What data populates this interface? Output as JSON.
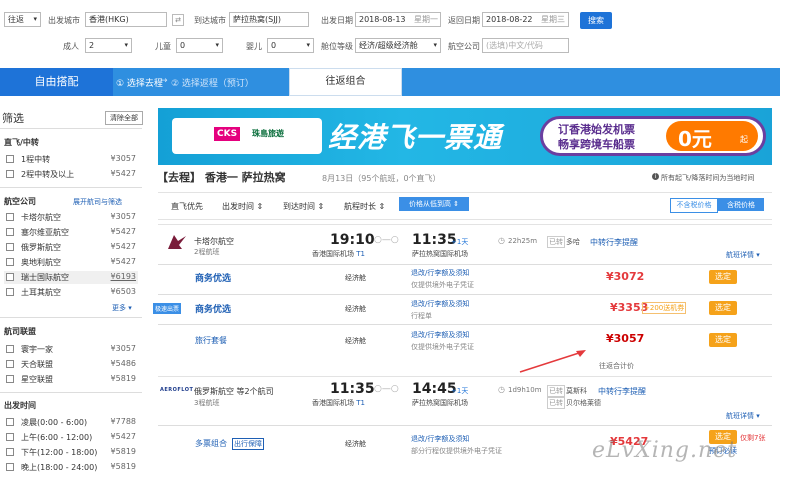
{
  "search": {
    "trip_type": "往返",
    "from_label": "出发城市",
    "from_value": "香港(HKG)",
    "to_label": "到达城市",
    "to_value": "萨拉热窝(SJJ)",
    "depart_label": "出发日期",
    "depart_date": "2018-08-13",
    "depart_weekday": "星期一",
    "return_label": "返回日期",
    "return_date": "2018-08-22",
    "return_weekday": "星期三",
    "search_button": "搜索",
    "adult_label": "成人",
    "adult_value": "2",
    "child_label": "儿童",
    "child_value": "0",
    "infant_label": "婴儿",
    "infant_value": "0",
    "cabin_label": "舱位等级",
    "cabin_value": "经济/超级经济舱",
    "airline_label": "航空公司",
    "airline_placeholder": "(选填)中文/代码"
  },
  "tabs": {
    "free": "自由搭配",
    "step1": "① 选择去程",
    "arrow": "→",
    "step2": "② 选择返程（预订）",
    "roundtrip": "往返组合"
  },
  "sidebar": {
    "title": "筛选",
    "clear": "清除全部",
    "stops_title": "直飞/中转",
    "stops": [
      {
        "label": "1程中转",
        "price": "¥3057"
      },
      {
        "label": "2程中转及以上",
        "price": "¥5427"
      }
    ],
    "airline_title": "航空公司",
    "airline_link": "展开航司与筛选",
    "airlines": [
      {
        "label": "卡塔尔航空",
        "price": "¥3057"
      },
      {
        "label": "塞尔维亚航空",
        "price": "¥5427"
      },
      {
        "label": "俄罗斯航空",
        "price": "¥5427"
      },
      {
        "label": "奥地利航空",
        "price": "¥5427"
      },
      {
        "label": "瑞士国际航空",
        "price": "¥6193"
      },
      {
        "label": "土耳其航空",
        "price": "¥6503"
      }
    ],
    "more": "更多 ▾",
    "alliance_title": "航司联盟",
    "alliances": [
      {
        "label": "寰宇一家",
        "price": "¥3057"
      },
      {
        "label": "天合联盟",
        "price": "¥5486"
      },
      {
        "label": "星空联盟",
        "price": "¥5819"
      }
    ],
    "time_title": "出发时间",
    "times": [
      {
        "label": "凌晨(0:00 - 6:00)",
        "price": "¥7788"
      },
      {
        "label": "上午(6:00 - 12:00)",
        "price": "¥5427"
      },
      {
        "label": "下午(12:00 - 18:00)",
        "price": "¥5819"
      },
      {
        "label": "晚上(18:00 - 24:00)",
        "price": "¥5819"
      }
    ]
  },
  "banner": {
    "logo1": "CKS",
    "logo2": "珠島旅遊",
    "slogan": "经港飞一票通",
    "promo_line1": "订香港始发机票",
    "promo_line2": "畅享跨境车船票",
    "promo_price": "0元",
    "promo_suffix": "起"
  },
  "results": {
    "heading": "【去程】 香港一 萨拉热窝",
    "subheading": "8月13日（95个航班，0个直飞）",
    "note": "所有起飞/降落时间为当地时间",
    "sort": {
      "direct": "直飞优先",
      "depart": "出发时间",
      "arrive": "到达时间",
      "duration": "航程时长",
      "price": "价格从低到高",
      "no_tax": "不含税价格",
      "with_tax": "含税价格"
    },
    "flight1": {
      "airline": "卡塔尔航空",
      "legs": "2程航班",
      "dep_time": "19:10",
      "dep_airport": "香港国际机场",
      "dep_terminal": "T1",
      "arr_time": "11:35",
      "arr_plus": "+1天",
      "arr_airport": "萨拉热窝国际机场",
      "duration": "22h25m",
      "transfer_tag": "已转",
      "transfer_city": "多哈",
      "transit_link": "中转行李提醒",
      "detail_link": "航班详情 ▾",
      "fares": [
        {
          "name": "商务优选",
          "cabin": "经济舱",
          "policy": "退改/行李额及须知",
          "sub": "仅提供境外电子凭证",
          "price": "¥3072",
          "book": "选定"
        },
        {
          "name": "商务优选",
          "cabin": "经济舱",
          "policy": "退改/行李额及须知",
          "sub": "行程单",
          "price": "¥3353",
          "book": "选定",
          "badge": "极速出票",
          "extra": "+200送机券"
        },
        {
          "name": "旅行套餐",
          "cabin": "经济舱",
          "policy": "退改/行李额及须知",
          "sub": "仅提供境外电子凭证",
          "price": "¥3057",
          "book": "选定"
        }
      ],
      "combo_note": "往返合计价"
    },
    "flight2": {
      "airline": "俄罗斯航空 等2个航司",
      "legs": "3程航班",
      "logo_text": "AEROFLOT",
      "dep_time": "11:35",
      "dep_airport": "香港国际机场",
      "dep_terminal": "T1",
      "arr_time": "14:45",
      "arr_plus": "+1天",
      "arr_airport": "萨拉热窝国际机场",
      "duration": "1d9h10m",
      "transfer1": "莫斯科",
      "transfer2": "贝尔格莱德",
      "transit_link": "中转行李提醒",
      "detail_link": "航班详情 ▾",
      "fare_name": "多票组合",
      "fare_tag": "出行保障",
      "cabin": "经济舱",
      "policy": "退改/行李额及须知",
      "sub": "部分行程仅提供境外电子凭证",
      "price": "¥5427",
      "book": "选定",
      "left": "仅剩7张",
      "note2": "预订必读"
    }
  },
  "watermark": "eLvXing.net",
  "colors": {
    "brand": "#1e73d8",
    "price": "#e4393c",
    "book": "#f5a21a",
    "tab_bar": "#2f8fe0"
  }
}
